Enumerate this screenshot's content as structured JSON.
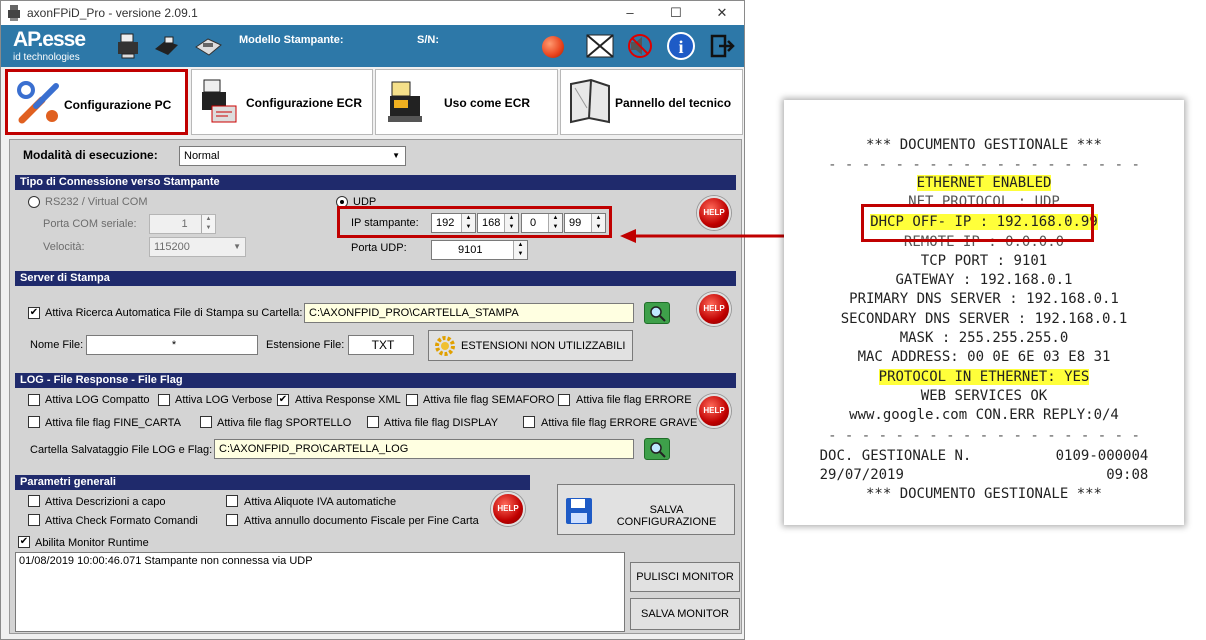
{
  "window": {
    "title": "axonFPiD_Pro - versione 2.09.1",
    "minimize": "–",
    "maximize": "☐",
    "close": "✕"
  },
  "banner": {
    "logo_main": "AP.esse",
    "logo_sub": "id technologies",
    "printer_model_label": "Modello Stampante:",
    "serial_label": "S/N:",
    "status_color": "#e8421c",
    "icons": [
      "printer-icon",
      "receipt-printer-icon",
      "cash-register-icon",
      "status-led-icon",
      "network-disconnected-icon",
      "sound-off-icon",
      "info-icon",
      "exit-icon"
    ]
  },
  "tabs": [
    {
      "label": "Configurazione PC",
      "icon": "tools-icon"
    },
    {
      "label": "Configurazione ECR",
      "icon": "ecr-config-icon"
    },
    {
      "label": "Uso come ECR",
      "icon": "cash-register-icon"
    },
    {
      "label": "Pannello del tecnico",
      "icon": "technician-panel-icon"
    }
  ],
  "mode": {
    "label": "Modalità di esecuzione:",
    "value": "Normal"
  },
  "connection": {
    "title": "Tipo di Connessione verso Stampante",
    "rs232_label": "RS232 / Virtual COM",
    "com_port_label": "Porta COM seriale:",
    "com_port_value": "1",
    "speed_label": "Velocità:",
    "speed_value": "115200",
    "udp_label": "UDP",
    "ip_label": "IP stampante:",
    "ip": [
      "192",
      "168",
      "0",
      "99"
    ],
    "udp_port_label": "Porta UDP:",
    "udp_port_value": "9101",
    "help": "HELP"
  },
  "print_server": {
    "title": "Server di Stampa",
    "auto_search_label": "Attiva Ricerca Automatica File di Stampa su Cartella:",
    "folder_value": "C:\\AXONFPID_PRO\\CARTELLA_STAMPA",
    "file_name_label": "Nome File:",
    "file_name_value": "*",
    "extension_label": "Estensione File:",
    "extension_value": "TXT",
    "unused_ext_button": "ESTENSIONI NON UTILIZZABILI",
    "help": "HELP"
  },
  "log": {
    "title": "LOG - File Response - File Flag",
    "opts": [
      {
        "label": "Attiva LOG Compatto",
        "checked": false
      },
      {
        "label": "Attiva LOG Verbose",
        "checked": false
      },
      {
        "label": "Attiva Response XML",
        "checked": true
      },
      {
        "label": "Attiva file flag SEMAFORO",
        "checked": false
      },
      {
        "label": "Attiva file flag ERRORE",
        "checked": false
      },
      {
        "label": "Attiva file flag FINE_CARTA",
        "checked": false
      },
      {
        "label": "Attiva file flag SPORTELLO",
        "checked": false
      },
      {
        "label": "Attiva file flag DISPLAY",
        "checked": false
      },
      {
        "label": "Attiva file flag ERRORE GRAVE",
        "checked": false
      }
    ],
    "folder_label": "Cartella Salvataggio File LOG e Flag:",
    "folder_value": "C:\\AXONFPID_PRO\\CARTELLA_LOG",
    "help": "HELP"
  },
  "general": {
    "title": "Parametri generali",
    "opts": [
      {
        "label": "Attiva Descrizioni a capo",
        "checked": false
      },
      {
        "label": "Attiva Aliquote IVA automatiche",
        "checked": false
      },
      {
        "label": "Attiva Check Formato Comandi",
        "checked": false
      },
      {
        "label": "Attiva annullo documento Fiscale per Fine Carta",
        "checked": false
      }
    ],
    "help": "HELP",
    "save_button": "SALVA CONFIGURAZIONE"
  },
  "monitor": {
    "enable_label": "Abilita Monitor Runtime",
    "enabled": true,
    "log_text": "01/08/2019 10:00:46.071  Stampante non connessa via UDP",
    "clear_button": "PULISCI MONITOR",
    "save_button": "SALVA MONITOR"
  },
  "receipt": {
    "lines": [
      {
        "text": "*** DOCUMENTO GESTIONALE ***",
        "hl": false
      },
      {
        "text": "- - - - - - - - - - - - - - - - - - -",
        "hl": false
      },
      {
        "text": "ETHERNET ENABLED",
        "hl": true
      },
      {
        "text": "NET PROTOCOL : UDP",
        "hl": false
      },
      {
        "text": "DHCP OFF- IP : 192.168.0.99",
        "hl": true
      },
      {
        "text": "REMOTE IP : 0.0.0.0",
        "hl": false
      },
      {
        "text": "TCP PORT : 9101",
        "hl": false
      },
      {
        "text": "GATEWAY : 192.168.0.1",
        "hl": false
      },
      {
        "text": "PRIMARY DNS SERVER : 192.168.0.1",
        "hl": false
      },
      {
        "text": "SECONDARY DNS SERVER : 192.168.0.1",
        "hl": false
      },
      {
        "text": "MASK : 255.255.255.0",
        "hl": false
      },
      {
        "text": "MAC ADDRESS: 00 0E 6E 03 E8 31",
        "hl": false
      },
      {
        "text": "PROTOCOL IN ETHERNET: YES",
        "hl": true
      },
      {
        "text": "WEB SERVICES OK",
        "hl": false
      },
      {
        "text": "www.google.com CON.ERR REPLY:0/4",
        "hl": false
      },
      {
        "text": "- - - - - - - - - - - - - - - - - - -",
        "hl": false
      },
      {
        "text": "DOC. GESTIONALE N.          0109-000004",
        "hl": false
      },
      {
        "text": "29/07/2019                        09:08",
        "hl": false
      },
      {
        "text": "*** DOCUMENTO GESTIONALE ***",
        "hl": false
      }
    ]
  }
}
